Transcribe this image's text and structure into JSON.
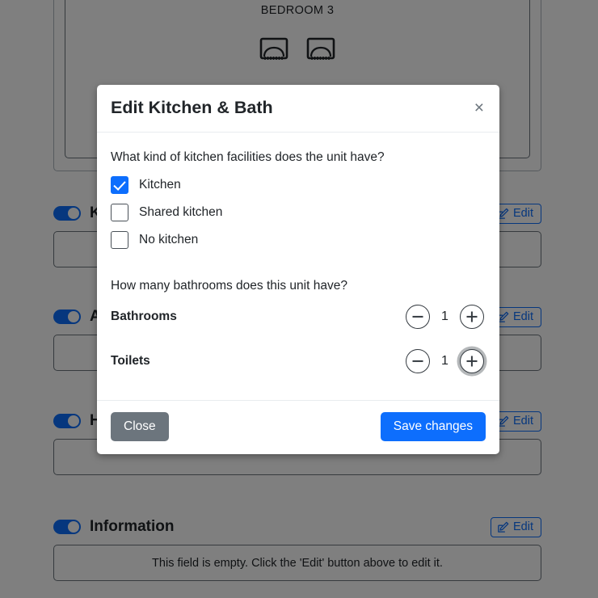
{
  "background": {
    "room_card": {
      "title": "BEDROOM 3",
      "bed_icon": "bed-icon",
      "bed_count": 2
    },
    "fields": [
      {
        "label": "Kitchen & Bath",
        "toggle_on": true,
        "edit_label": "Edit",
        "edit_icon": "pencil-square-icon",
        "body_text": ""
      },
      {
        "label": "Amenities",
        "toggle_on": true,
        "edit_label": "Edit",
        "edit_icon": "pencil-square-icon",
        "body_text": ""
      },
      {
        "label": "House Rules",
        "toggle_on": true,
        "edit_label": "Edit",
        "edit_icon": "pencil-square-icon",
        "body_text": ""
      },
      {
        "label": "Information",
        "toggle_on": true,
        "edit_label": "Edit",
        "edit_icon": "pencil-square-icon",
        "body_text": "This field is empty. Click the 'Edit' button above to edit it."
      }
    ]
  },
  "modal": {
    "title": "Edit Kitchen & Bath",
    "close_icon": "close-icon",
    "question_kitchen": "What kind of kitchen facilities does the unit have?",
    "kitchen_options": [
      {
        "label": "Kitchen",
        "checked": true
      },
      {
        "label": "Shared kitchen",
        "checked": false
      },
      {
        "label": "No kitchen",
        "checked": false
      }
    ],
    "question_bathrooms": "How many bathrooms does this unit have?",
    "steppers": [
      {
        "label": "Bathrooms",
        "value": "1",
        "minus_icon": "minus-circle-icon",
        "plus_icon": "plus-circle-icon",
        "plus_focused": false
      },
      {
        "label": "Toilets",
        "value": "1",
        "minus_icon": "minus-circle-icon",
        "plus_icon": "plus-circle-icon",
        "plus_focused": true
      }
    ],
    "close_label": "Close",
    "save_label": "Save changes"
  },
  "colors": {
    "accent_blue": "#0d6efd",
    "secondary_gray": "#6c757d",
    "overlay": "rgba(0,0,0,0.5)"
  }
}
